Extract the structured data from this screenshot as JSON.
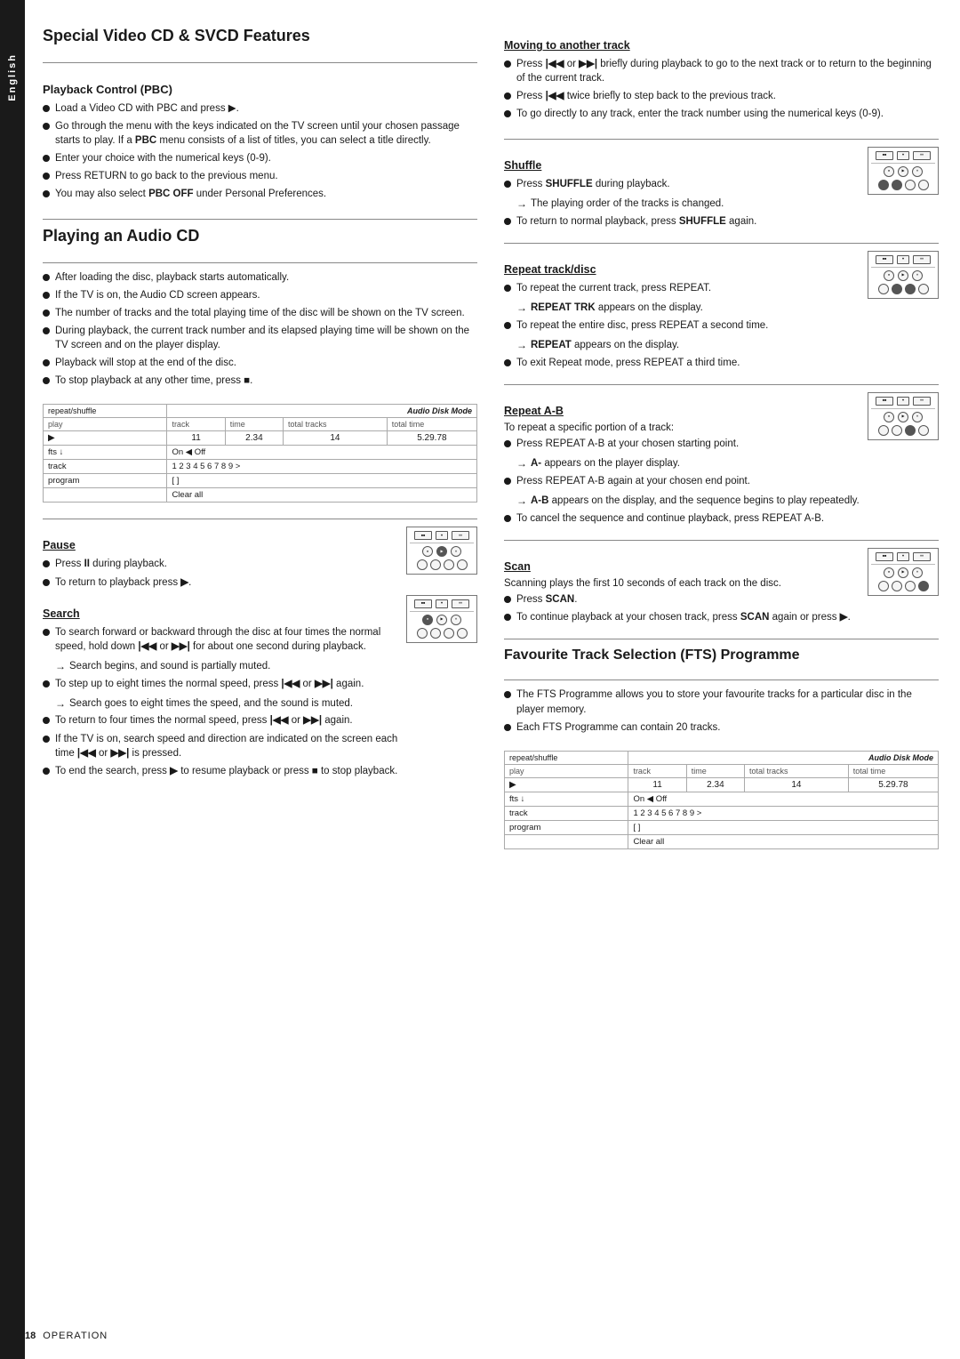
{
  "sidebar": {
    "language": "English"
  },
  "page_footer": {
    "page_number": "18",
    "label": "Operation"
  },
  "left_column": {
    "section1": {
      "title": "Special Video CD & SVCD Features",
      "subsection1": {
        "heading": "Playback Control (PBC)",
        "items": [
          "Load a Video CD with PBC and press ▶.",
          "Go through the menu with the keys indicated on the TV screen until your chosen passage starts to play. If a PBC menu consists of a list of titles, you can select a title directly.",
          "Enter your choice with the numerical keys (0-9).",
          "Press RETURN to go back to the previous menu.",
          "You may also select PBC OFF under Personal Preferences."
        ]
      }
    },
    "section2": {
      "title": "Playing an Audio CD",
      "items": [
        "After loading the disc, playback starts automatically.",
        "If the TV is on, the Audio CD screen appears.",
        "The number of tracks and the total playing time of the disc will be shown on the TV screen.",
        "During playback, the current track number and its elapsed playing time will be shown on the TV screen and on the player display.",
        "Playback will stop at the end of the disc.",
        "To stop playback at any other time, press ■."
      ],
      "osd": {
        "mode_label": "Audio Disk Mode",
        "rows": [
          {
            "col1": "play",
            "col2": "track",
            "col3": "time",
            "col4": "total tracks",
            "col5": "total time"
          },
          {
            "col1": "▶",
            "col2": "11",
            "col3": "2.34",
            "col4": "14",
            "col5": "5.29.78"
          },
          {
            "col1": "fts ↓",
            "col2": "On ◀ Off",
            "col3": "",
            "col4": "",
            "col5": ""
          },
          {
            "col1": "track",
            "col2": "1  2  3  4  5  6  7  8  9  >",
            "col3": "",
            "col4": "",
            "col5": ""
          },
          {
            "col1": "program",
            "col2": "[ ]",
            "col3": "",
            "col4": "",
            "col5": ""
          },
          {
            "col1": "",
            "col2": "Clear all",
            "col3": "",
            "col4": "",
            "col5": ""
          }
        ]
      }
    },
    "section3": {
      "heading": "Pause",
      "items": [
        "Press II during playback.",
        "To return to playback press ▶."
      ]
    },
    "section4": {
      "heading": "Search",
      "items": [
        "To search forward or backward through the disc at four times the normal speed, hold down |◀◀ or ▶▶| for about one second during playback.",
        "Search begins, and sound is partially muted.",
        "To step up to eight times the normal speed, press |◀◀ or ▶▶| again.",
        "Search goes to eight times the speed, and the sound is muted.",
        "To return to four times the normal speed, press |◀◀ or ▶▶| again.",
        "If the TV is on, search speed and direction are indicated on the screen each time |◀◀ or ▶▶| is pressed.",
        "To end the search, press ▶ to resume playback or press ■ to stop playback."
      ]
    }
  },
  "right_column": {
    "section1": {
      "heading": "Moving to another track",
      "items": [
        "Press |◀◀ or ▶▶| briefly during playback to go to the next track or to return to the beginning of the current track.",
        "Press |◀◀ twice briefly to step back to the previous track.",
        "To go directly to any track, enter the track number using the numerical keys (0-9)."
      ]
    },
    "section2": {
      "heading": "Shuffle",
      "items": [
        "Press SHUFFLE during playback.",
        "The playing order of the tracks is changed.",
        "To return to normal playback, press SHUFFLE again."
      ],
      "arrow1": "The playing order of the tracks is changed.",
      "arrow2": "To return to normal playback, press SHUFFLE again."
    },
    "section3": {
      "heading": "Repeat track/disc",
      "items": [
        "To repeat the current track, press REPEAT.",
        "REPEAT TRK appears on the display.",
        "To repeat the entire disc, press REPEAT a second time.",
        "REPEAT appears on the display.",
        "To exit Repeat mode, press REPEAT a third time."
      ]
    },
    "section4": {
      "heading": "Repeat A-B",
      "intro": "To repeat a specific portion of a track:",
      "items": [
        "Press REPEAT A-B at your chosen starting point.",
        "A- appears on the player display.",
        "Press REPEAT A-B again at your chosen end point.",
        "A-B appears on the display, and the sequence begins to play repeatedly.",
        "To cancel the sequence and continue playback, press REPEAT A-B."
      ]
    },
    "section5": {
      "heading": "Scan",
      "intro": "Scanning plays the first 10 seconds of each track on the disc.",
      "items": [
        "Press SCAN.",
        "To continue playback at your chosen track, press SCAN again or press ▶."
      ]
    },
    "section6": {
      "title": "Favourite Track Selection (FTS) Programme",
      "items": [
        "The FTS Programme allows you to store your favourite tracks for a particular disc in the player memory.",
        "Each FTS Programme can contain 20 tracks."
      ],
      "osd": {
        "mode_label": "Audio Disk Mode",
        "rows": [
          {
            "col1": "play",
            "col2": "track",
            "col3": "time",
            "col4": "total tracks",
            "col5": "total time"
          },
          {
            "col1": "▶",
            "col2": "11",
            "col3": "2.34",
            "col4": "14",
            "col5": "5.29.78"
          },
          {
            "col1": "fts ↓",
            "col2": "On ◀ Off",
            "col3": "",
            "col4": "",
            "col5": ""
          },
          {
            "col1": "track",
            "col2": "1  2  3  4  5  6  7  8  9  >",
            "col3": "",
            "col4": "",
            "col5": ""
          },
          {
            "col1": "program",
            "col2": "[ ]",
            "col3": "",
            "col4": "",
            "col5": ""
          },
          {
            "col1": "",
            "col2": "Clear all",
            "col3": "",
            "col4": "",
            "col5": ""
          }
        ]
      }
    }
  }
}
